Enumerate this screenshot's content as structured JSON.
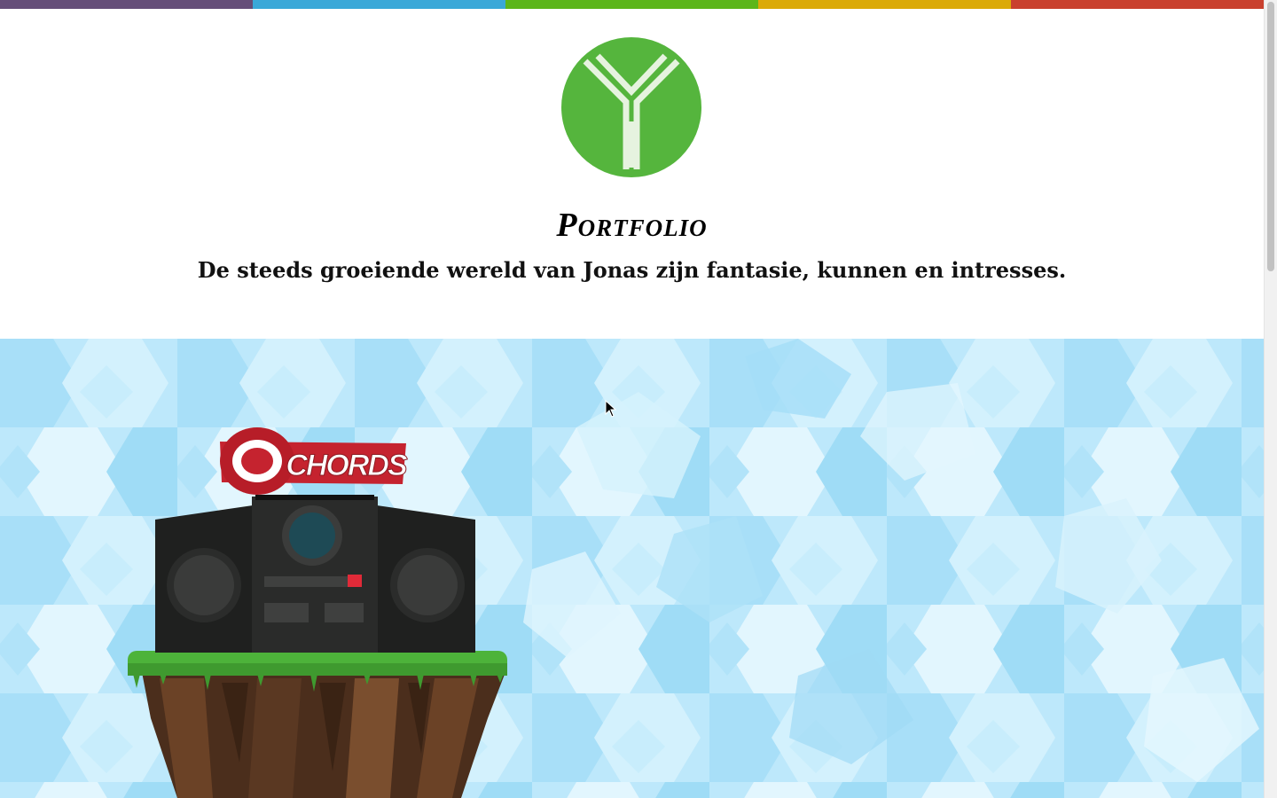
{
  "colorbar": {
    "colors": [
      "#654e79",
      "#3aa8d8",
      "#5cb61a",
      "#dbaa07",
      "#c9402e"
    ]
  },
  "logo": {
    "icon": "y-logo-icon",
    "color": "#55b53d"
  },
  "header": {
    "title": "Portfolio",
    "subtitle": "De steeds groeiende wereld van Jonas zijn fantasie, kunnen en intresses."
  },
  "project": {
    "logo_text": "CHORDS",
    "icon": "boombox-island-icon"
  }
}
